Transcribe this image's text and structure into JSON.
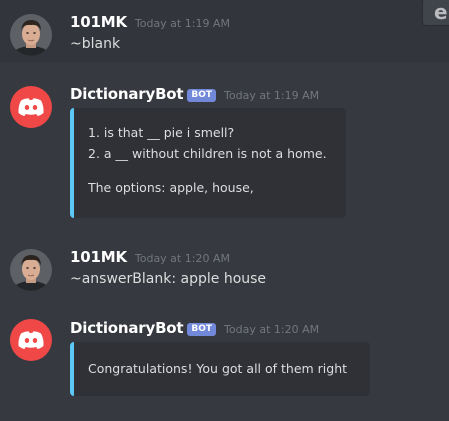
{
  "corner_icon": "e",
  "messages": [
    {
      "username": "101MK",
      "timestamp": "Today at 1:19 AM",
      "text": "~blank"
    },
    {
      "username": "DictionaryBot",
      "bot_tag": "BOT",
      "timestamp": "Today at 1:19 AM",
      "embed_lines": [
        "1. is that __ pie i smell?",
        "2. a __ without children is not a home.",
        "",
        "The options: apple, house,"
      ]
    },
    {
      "username": "101MK",
      "timestamp": "Today at 1:20 AM",
      "text": "~answerBlank: apple house"
    },
    {
      "username": "DictionaryBot",
      "bot_tag": "BOT",
      "timestamp": "Today at 1:20 AM",
      "embed_lines": [
        "Congratulations! You got all of them right"
      ]
    }
  ],
  "colors": {
    "background": "#36393f",
    "embed_background": "#2f3136",
    "embed_accent": "#5dc8f5",
    "bot_tag": "#7289da",
    "discord_avatar": "#f04747"
  }
}
